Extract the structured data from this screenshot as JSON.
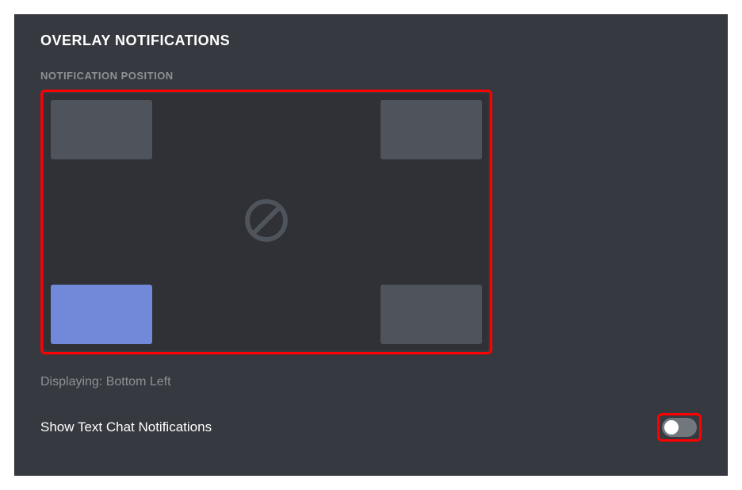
{
  "section": {
    "title": "OVERLAY NOTIFICATIONS",
    "positionLabel": "NOTIFICATION POSITION",
    "displayingText": "Displaying: Bottom Left"
  },
  "positions": {
    "topLeft": {
      "selected": false
    },
    "topRight": {
      "selected": false
    },
    "bottomLeft": {
      "selected": true
    },
    "bottomRight": {
      "selected": false
    }
  },
  "toggle": {
    "label": "Show Text Chat Notifications",
    "state": "off"
  },
  "colors": {
    "panelBg": "#36393f",
    "pickerBg": "#2f3136",
    "tileBg": "#4f545c",
    "tileSelected": "#7289da",
    "highlight": "#ff0000",
    "textPrimary": "#ffffff",
    "textMuted": "#8e9297",
    "toggleOff": "#72767d"
  }
}
